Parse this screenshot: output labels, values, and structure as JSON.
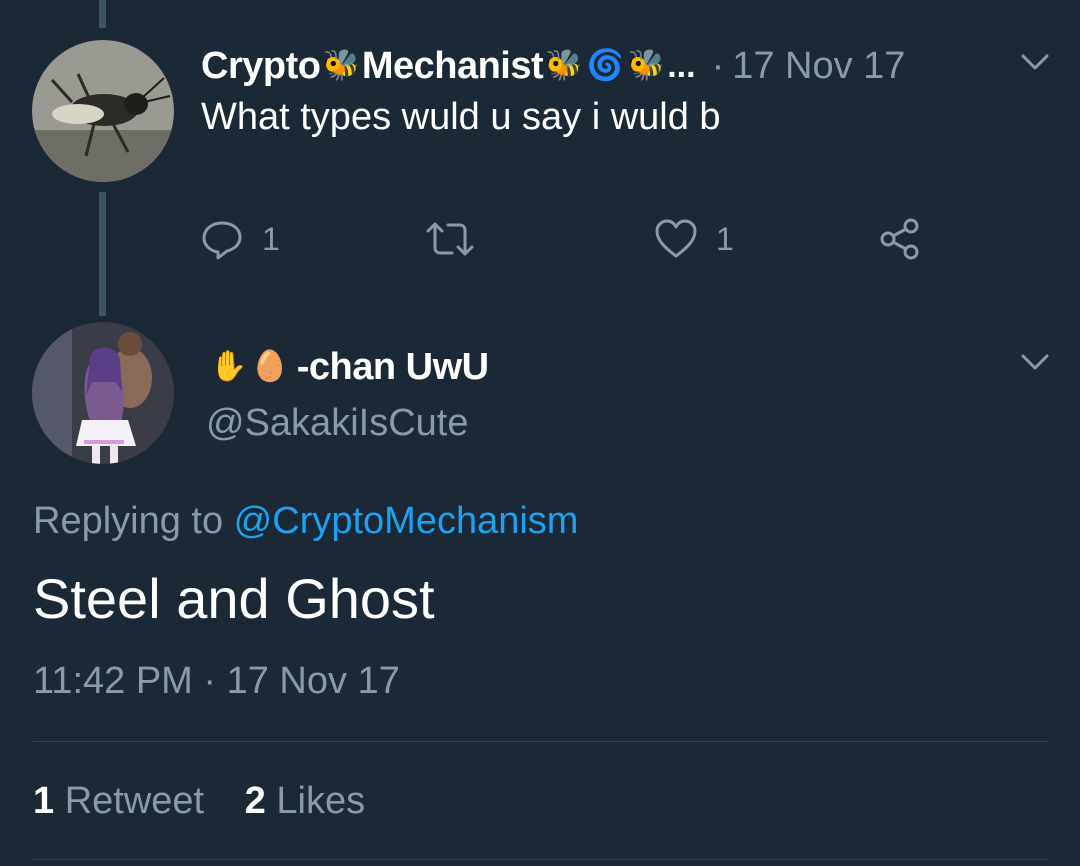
{
  "parent_tweet": {
    "display_name_part1": "Crypto",
    "display_name_part2": "Mechanist",
    "name_emojis": [
      "🐝",
      "🐝",
      "🌀",
      "🐝"
    ],
    "truncation": "...",
    "separator": "·",
    "time": "17 Nov 17",
    "text": "What types wuld u say i wuld b",
    "reply_count": "1",
    "like_count": "1",
    "icons": [
      "reply-icon",
      "retweet-icon",
      "like-icon",
      "share-icon",
      "chevron-down-icon"
    ]
  },
  "reply_tweet": {
    "name_emojis": [
      "✋",
      "🥚"
    ],
    "display_name": "-chan UwU",
    "handle": "@SakakiIsCute",
    "replying_prefix": "Replying to ",
    "replying_handle": "@CryptoMechanism",
    "text": "Steel and Ghost",
    "timestamp": "11:42 PM · 17 Nov 17",
    "retweet_count": "1",
    "retweet_label": "Retweet",
    "like_count": "2",
    "like_label": "Likes"
  },
  "colors": {
    "background": "#1b2836",
    "secondary_text": "#8b9aa8",
    "link": "#1da1f2",
    "thread_line": "#3d5466"
  }
}
